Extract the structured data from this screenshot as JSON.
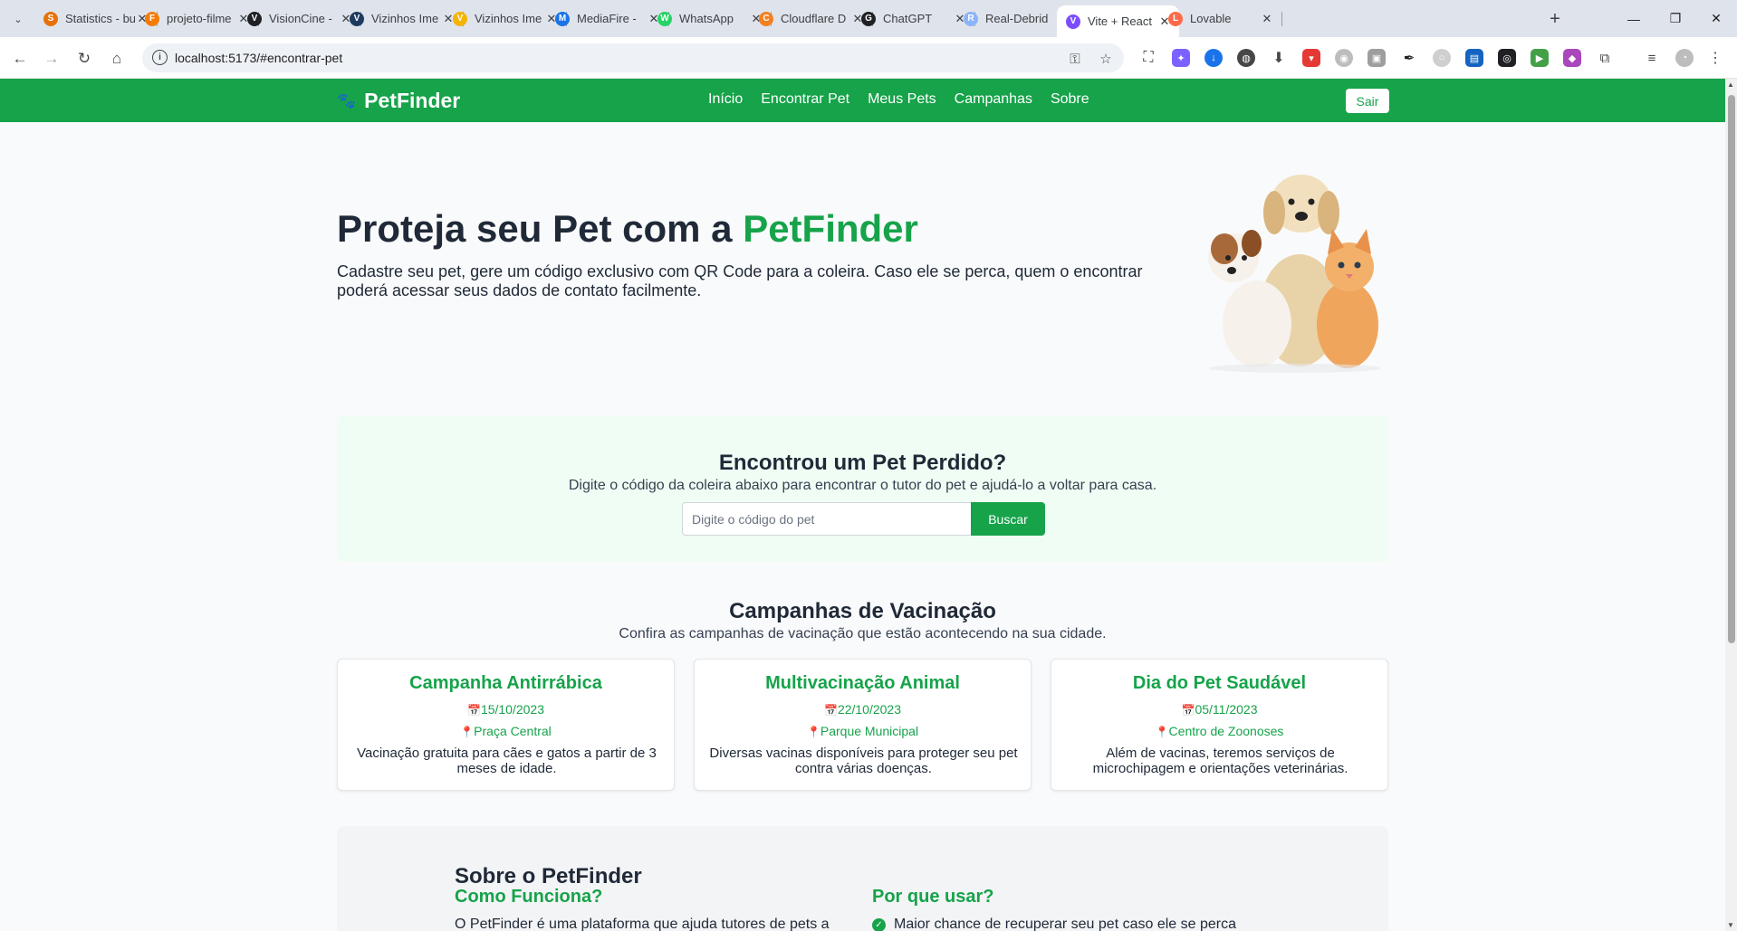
{
  "browser": {
    "tabs": [
      {
        "label": "Statistics - bu",
        "favicon_color": "#e8710a",
        "favicon_glyph": "S"
      },
      {
        "label": "projeto-filme",
        "favicon_color": "#f57c00",
        "favicon_glyph": "F"
      },
      {
        "label": "VisionCine -",
        "favicon_color": "#202124",
        "favicon_glyph": "V"
      },
      {
        "label": "Vizinhos Ime",
        "favicon_color": "#1e3a5f",
        "favicon_glyph": "V"
      },
      {
        "label": "Vizinhos Ime",
        "favicon_color": "#f4b400",
        "favicon_glyph": "V"
      },
      {
        "label": "MediaFire - ",
        "favicon_color": "#1a73e8",
        "favicon_glyph": "M"
      },
      {
        "label": "WhatsApp",
        "favicon_color": "#25d366",
        "favicon_glyph": "W"
      },
      {
        "label": "Cloudflare D",
        "favicon_color": "#f38020",
        "favicon_glyph": "C"
      },
      {
        "label": "ChatGPT",
        "favicon_color": "#202124",
        "favicon_glyph": "G"
      },
      {
        "label": "Real-Debrid",
        "favicon_color": "#8ab4f8",
        "favicon_glyph": "R"
      },
      {
        "label": "Vite + React",
        "favicon_color": "#7c4dff",
        "favicon_glyph": "V"
      },
      {
        "label": "Lovable",
        "favicon_color": "#ff6b4a",
        "favicon_glyph": "L"
      }
    ],
    "active_tab_index": 10,
    "new_tab_glyph": "+",
    "url": "localhost:5173/#encontrar-pet",
    "window_controls": {
      "minimize": "—",
      "restore": "❐",
      "close": "✕"
    }
  },
  "app": {
    "brand": "PetFinder",
    "nav": [
      "Início",
      "Encontrar Pet",
      "Meus Pets",
      "Campanhas",
      "Sobre"
    ],
    "logout_label": "Sair",
    "accent_color": "#16a34a"
  },
  "hero": {
    "title_prefix": "Proteja seu Pet com a ",
    "title_accent": "PetFinder",
    "description": "Cadastre seu pet, gere um código exclusivo com QR Code para a coleira. Caso ele se perca, quem o encontrar poderá acessar seus dados de contato facilmente."
  },
  "finder": {
    "title": "Encontrou um Pet Perdido?",
    "subtitle": "Digite o código da coleira abaixo para encontrar o tutor do pet e ajudá-lo a voltar para casa.",
    "input_placeholder": "Digite o código do pet",
    "button_label": "Buscar"
  },
  "campaigns": {
    "title": "Campanhas de Vacinação",
    "subtitle": "Confira as campanhas de vacinação que estão acontecendo na sua cidade.",
    "items": [
      {
        "title": "Campanha Antirrábica",
        "date": "15/10/2023",
        "location": "Praça Central",
        "description": "Vacinação gratuita para cães e gatos a partir de 3 meses de idade."
      },
      {
        "title": "Multivacinação Animal",
        "date": "22/10/2023",
        "location": "Parque Municipal",
        "description": "Diversas vacinas disponíveis para proteger seu pet contra várias doenças."
      },
      {
        "title": "Dia do Pet Saudável",
        "date": "05/11/2023",
        "location": "Centro de Zoonoses",
        "description": "Além de vacinas, teremos serviços de microchipagem e orientações veterinárias."
      }
    ]
  },
  "about": {
    "title": "Sobre o PetFinder",
    "how_title": "Como Funciona?",
    "how_text": "O PetFinder é uma plataforma que ajuda tutores de pets a",
    "why_title": "Por que usar?",
    "why_items": [
      "Maior chance de recuperar seu pet caso ele se perca"
    ]
  }
}
